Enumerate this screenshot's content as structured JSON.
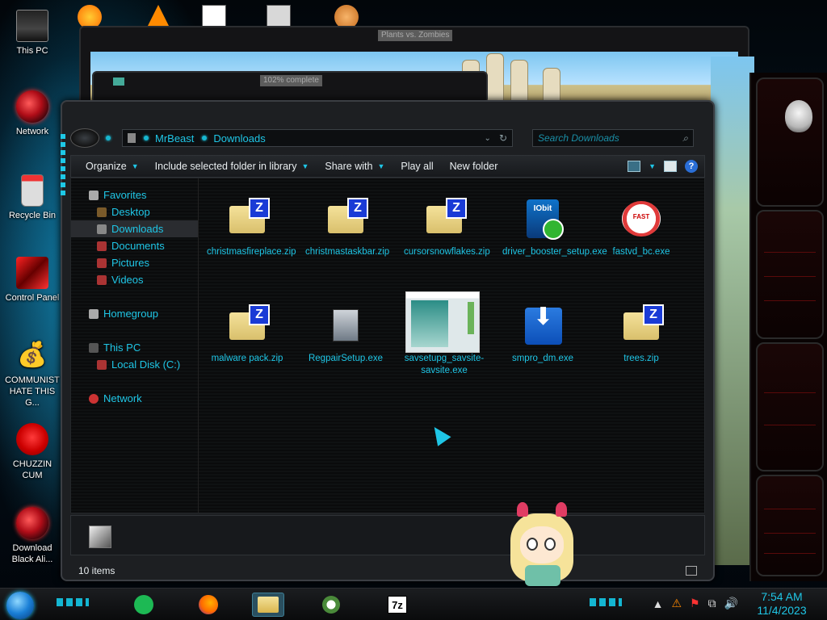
{
  "desktop": {
    "icons": [
      {
        "label": "This PC",
        "icon": "this-pc-icon"
      },
      {
        "label": "Network",
        "icon": "network-orb-icon"
      },
      {
        "label": "Recycle Bin",
        "icon": "recycle-bin-icon"
      },
      {
        "label": "Control Panel",
        "icon": "control-panel-icon"
      },
      {
        "label": "COMMUNIST HATE THIS G...",
        "icon": "money-bag-icon"
      },
      {
        "label": "CHUZZIN CUM",
        "icon": "chuzzle-icon"
      },
      {
        "label": "Download Black Ali...",
        "icon": "alienware-orb-icon"
      }
    ]
  },
  "background_windows": {
    "game_title": "Plants vs. Zombies",
    "progress_title": "102% complete"
  },
  "explorer": {
    "address": {
      "crumbs": [
        "MrBeast",
        "Downloads"
      ]
    },
    "search_placeholder": "Search Downloads",
    "toolbar": {
      "organize": "Organize",
      "include": "Include selected folder in library",
      "share": "Share with",
      "play_all": "Play all",
      "new_folder": "New folder"
    },
    "sidebar": {
      "favorites": "Favorites",
      "desktop": "Desktop",
      "downloads": "Downloads",
      "documents": "Documents",
      "pictures": "Pictures",
      "videos": "Videos",
      "homegroup": "Homegroup",
      "this_pc": "This PC",
      "local_disk": "Local Disk (C:)",
      "network": "Network"
    },
    "files": [
      {
        "name": "christmasfireplace.zip",
        "type": "zip"
      },
      {
        "name": "christmastaskbar.zip",
        "type": "zip"
      },
      {
        "name": "cursorsnowflakes.zip",
        "type": "zip"
      },
      {
        "name": "driver_booster_setup.exe",
        "type": "iobit"
      },
      {
        "name": "fastvd_bc.exe",
        "type": "fastvd"
      },
      {
        "name": "malware pack.zip",
        "type": "zip"
      },
      {
        "name": "RegpairSetup.exe",
        "type": "regpair"
      },
      {
        "name": "savsetupg_savsite-savsite.exe",
        "type": "savsite"
      },
      {
        "name": "smpro_dm.exe",
        "type": "smpro"
      },
      {
        "name": "trees.zip",
        "type": "zip"
      }
    ],
    "status": "10 items"
  },
  "taskbar": {
    "time": "7:54 AM",
    "date": "11/4/2023"
  },
  "colors": {
    "accent": "#1fc6e6",
    "window_bg": "#1d1f22",
    "gadget_red": "#ff2a2a"
  }
}
